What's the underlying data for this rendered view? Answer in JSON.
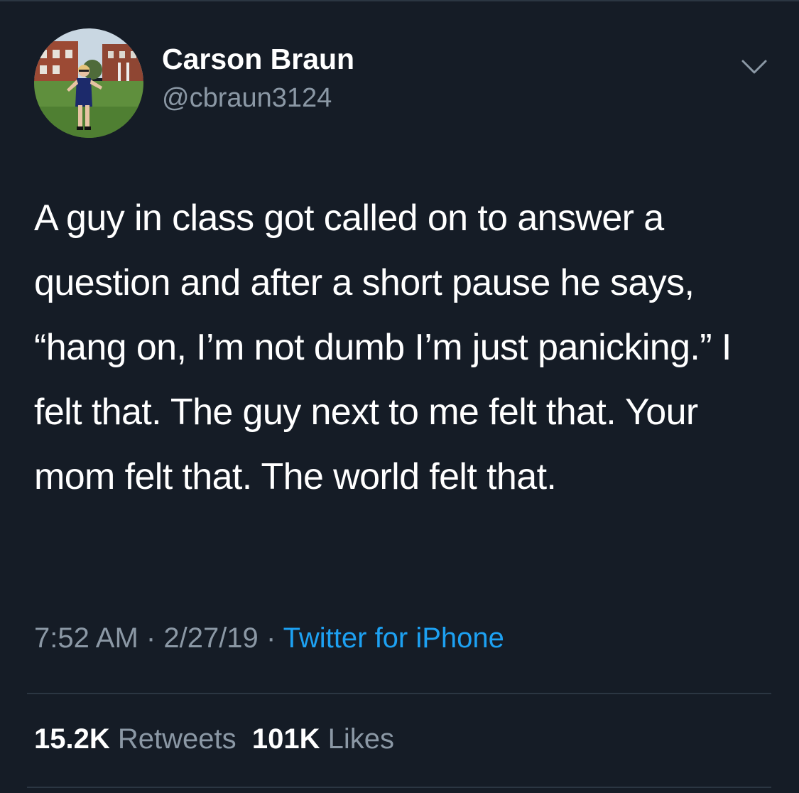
{
  "author": {
    "display_name": "Carson Braun",
    "handle": "@cbraun3124",
    "avatar_icon": "profile-photo"
  },
  "tweet": {
    "text": "A guy in class got called on to answer a question and after a short pause he says, “hang on, I’m not dumb I’m just panicking.” I felt that. The guy next to me felt that. Your mom felt that. The world felt that.",
    "time": "7:52 AM",
    "date": "2/27/19",
    "separator": "·",
    "source": "Twitter for iPhone"
  },
  "stats": {
    "retweets_count": "15.2K",
    "retweets_label": "Retweets",
    "likes_count": "101K",
    "likes_label": "Likes"
  },
  "icons": {
    "menu": "chevron-down-icon"
  },
  "colors": {
    "background": "#151c26",
    "secondary_text": "#8b98a5",
    "link": "#1da1f2",
    "divider": "#2b3642"
  }
}
